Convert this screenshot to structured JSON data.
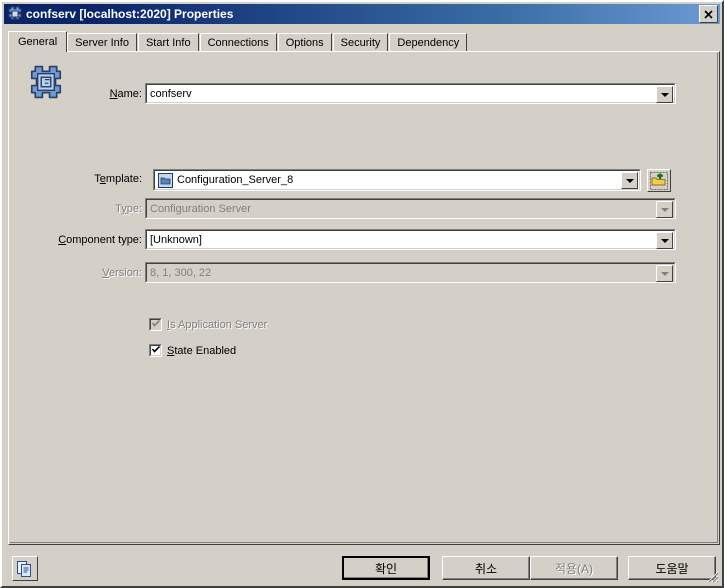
{
  "window": {
    "title": "confserv [localhost:2020] Properties",
    "icon": "server-component-icon",
    "close_label": "✕"
  },
  "tabs": [
    {
      "label": "General",
      "active": true
    },
    {
      "label": "Server Info",
      "active": false
    },
    {
      "label": "Start Info",
      "active": false
    },
    {
      "label": "Connections",
      "active": false
    },
    {
      "label": "Options",
      "active": false
    },
    {
      "label": "Security",
      "active": false
    },
    {
      "label": "Dependency",
      "active": false
    }
  ],
  "general": {
    "header_icon": "server-component-large-icon",
    "fields": [
      {
        "label_pre": "",
        "label_mnemonic": "N",
        "label_post": "ame:",
        "value": "confserv",
        "enabled": true,
        "has_icon": false,
        "has_browse": false
      },
      {
        "label_pre": "T",
        "label_mnemonic": "e",
        "label_post": "mplate:",
        "value": "Configuration_Server_8",
        "enabled": true,
        "has_icon": true,
        "icon": "template-folder-icon",
        "has_browse": true,
        "browse_icon": "browse-open-icon"
      },
      {
        "label_pre": "T",
        "label_mnemonic": "y",
        "label_post": "pe:",
        "value": "Configuration Server",
        "enabled": false,
        "has_icon": false,
        "has_browse": false
      },
      {
        "label_pre": "",
        "label_mnemonic": "C",
        "label_post": "omponent type:",
        "value": "[Unknown]",
        "enabled": true,
        "has_icon": false,
        "has_browse": false
      },
      {
        "label_pre": "",
        "label_mnemonic": "V",
        "label_post": "ersion:",
        "value": "8, 1, 300, 22",
        "enabled": false,
        "has_icon": false,
        "has_browse": false
      }
    ],
    "checkboxes": [
      {
        "label_pre": "",
        "label_mnemonic": "I",
        "label_post": "s Application Server",
        "checked": true,
        "enabled": false
      },
      {
        "label_pre": "",
        "label_mnemonic": "S",
        "label_post": "tate Enabled",
        "checked": true,
        "enabled": true
      }
    ]
  },
  "footer": {
    "copy_icon": "copy-documents-icon",
    "buttons": [
      {
        "label": "확인",
        "default": true,
        "enabled": true
      },
      {
        "label": "취소",
        "default": false,
        "enabled": true
      },
      {
        "label": "적용(A)",
        "default": false,
        "enabled": false
      },
      {
        "label": "도움말",
        "default": false,
        "enabled": true
      }
    ]
  },
  "colors": {
    "face": "#d4d0c8",
    "title_start": "#0a246a",
    "title_end": "#6d9ad4",
    "disabled_text": "#808080"
  }
}
